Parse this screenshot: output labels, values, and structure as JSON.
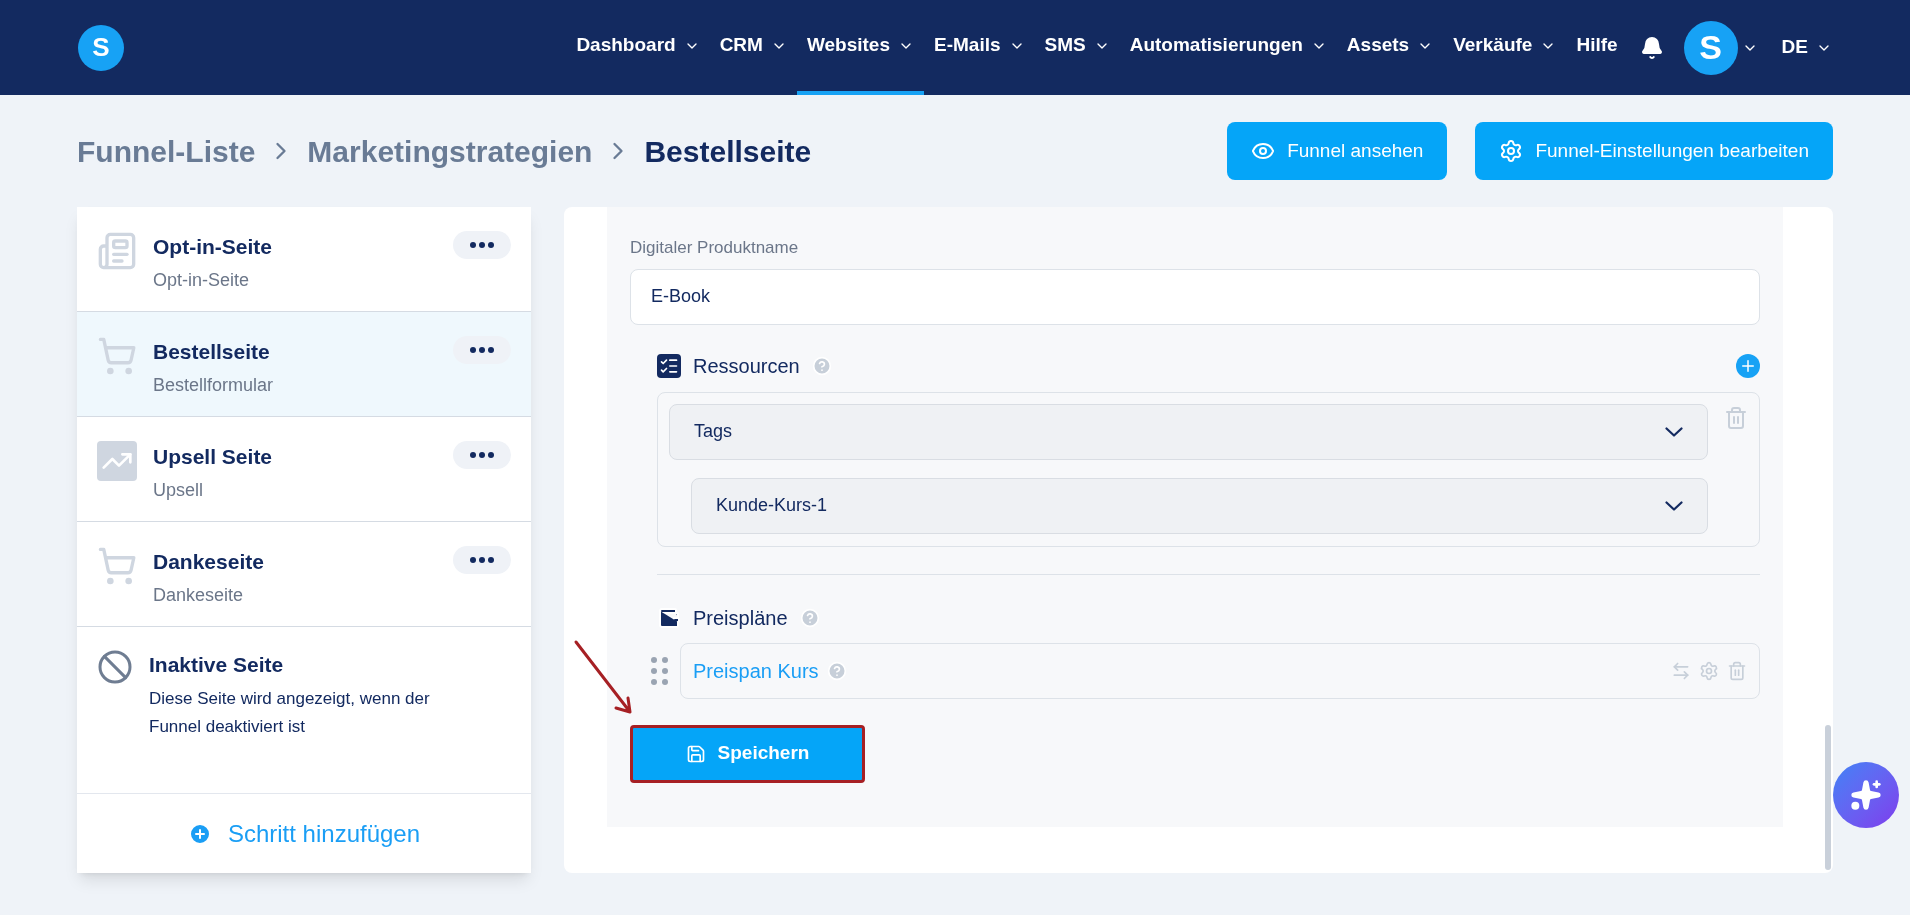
{
  "header": {
    "logo": "S",
    "nav": [
      {
        "label": "Dashboard",
        "selected": false,
        "dropdown": true
      },
      {
        "label": "CRM",
        "selected": false,
        "dropdown": true
      },
      {
        "label": "Websites",
        "selected": true,
        "dropdown": true
      },
      {
        "label": "E-Mails",
        "selected": false,
        "dropdown": true
      },
      {
        "label": "SMS",
        "selected": false,
        "dropdown": true
      },
      {
        "label": "Automatisierungen",
        "selected": false,
        "dropdown": true
      },
      {
        "label": "Assets",
        "selected": false,
        "dropdown": true
      },
      {
        "label": "Verkäufe",
        "selected": false,
        "dropdown": true
      },
      {
        "label": "Hilfe",
        "selected": false,
        "dropdown": false
      }
    ],
    "avatar": "S",
    "language": "DE"
  },
  "breadcrumb": [
    "Funnel-Liste",
    "Marketingstrategien",
    "Bestellseite"
  ],
  "actions": [
    {
      "kind": "view",
      "label": "Funnel ansehen"
    },
    {
      "kind": "settings",
      "label": "Funnel-Einstellungen bearbeiten"
    }
  ],
  "steps": [
    {
      "kind": "optin",
      "title": "Opt-in-Seite",
      "subtitle": "Opt-in-Seite",
      "selected": false
    },
    {
      "kind": "order",
      "title": "Bestellseite",
      "subtitle": "Bestellformular",
      "selected": true
    },
    {
      "kind": "upsell",
      "title": "Upsell Seite",
      "subtitle": "Upsell",
      "selected": false
    },
    {
      "kind": "thanks",
      "title": "Dankeseite",
      "subtitle": "Dankeseite",
      "selected": false
    }
  ],
  "inactive": {
    "title": "Inaktive Seite",
    "description": "Diese Seite wird angezeigt, wenn der Funnel deaktiviert ist"
  },
  "add_step": "Schritt hinzufügen",
  "form": {
    "product_label": "Digitaler Produktname",
    "product_value": "E-Book",
    "resources": {
      "title": "Ressourcen",
      "type": "Tags",
      "value": "Kunde-Kurs-1"
    },
    "price_plans": {
      "title": "Preispläne",
      "items": [
        {
          "name": "Preispan Kurs"
        }
      ]
    },
    "save": "Speichern"
  }
}
